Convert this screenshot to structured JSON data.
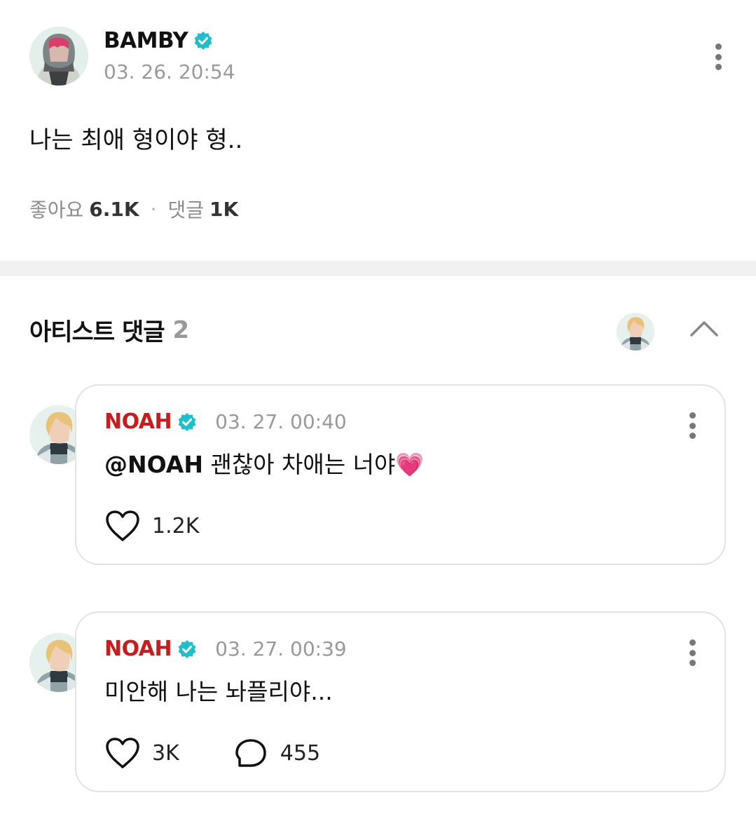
{
  "post": {
    "author": "BAMBY",
    "time": "03. 26. 20:54",
    "body": "나는 최애 형이야 형..",
    "likes_label": "좋아요",
    "likes": "6.1K",
    "separator": "·",
    "comments_label": "댓글",
    "comments": "1K"
  },
  "section": {
    "title": "아티스트 댓글",
    "count": "2"
  },
  "comments": [
    {
      "author": "NOAH",
      "time": "03. 27. 00:40",
      "mention": "@NOAH",
      "text": "괜찮아 차애는 너야",
      "emoji": "💗",
      "likes": "1.2K"
    },
    {
      "author": "NOAH",
      "time": "03. 27. 00:39",
      "text": "미안해 나는 놔플리야...",
      "likes": "3K",
      "replies": "455"
    }
  ],
  "colors": {
    "verified_badge": "#1fbfc9",
    "artist_name": "#c41e1e",
    "muted_text": "#999999",
    "divider": "#f1f1f1"
  },
  "icons": [
    "verified-badge-icon",
    "more-vertical-icon",
    "chevron-up-icon",
    "heart-icon",
    "comment-bubble-icon"
  ]
}
